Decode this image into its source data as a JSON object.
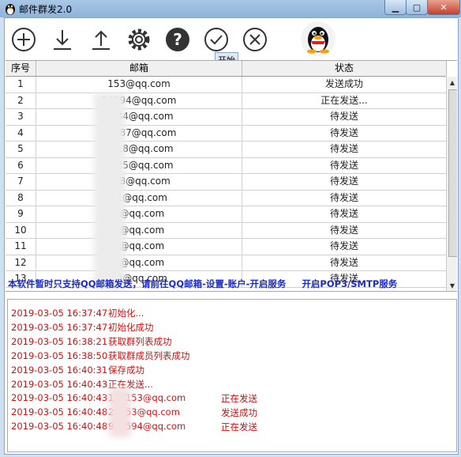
{
  "window": {
    "title": "邮件群发2.0"
  },
  "toolbar": {
    "buttons": [
      {
        "name": "add-button",
        "icon": "plus-circle-icon"
      },
      {
        "name": "import-button",
        "icon": "download-arrow-icon"
      },
      {
        "name": "export-button",
        "icon": "upload-arrow-icon"
      },
      {
        "name": "settings-button",
        "icon": "gear-icon"
      },
      {
        "name": "help-button",
        "icon": "question-icon"
      },
      {
        "name": "start-button",
        "icon": "check-circle-icon"
      },
      {
        "name": "stop-button",
        "icon": "x-circle-icon"
      }
    ],
    "tooltip": "开始",
    "qq_icon": "qq-penguin-icon"
  },
  "table": {
    "headers": {
      "index": "序号",
      "email": "邮箱",
      "status": "状态"
    },
    "rows": [
      {
        "index": "1",
        "email": "153@qq.com",
        "status": "发送成功"
      },
      {
        "index": "2",
        "email": "54594@qq.com",
        "status": "正在发送..."
      },
      {
        "index": "3",
        "email": "1834@qq.com",
        "status": "待发送"
      },
      {
        "index": "4",
        "email": "94087@qq.com",
        "status": "待发送"
      },
      {
        "index": "5",
        "email": "5418@qq.com",
        "status": "待发送"
      },
      {
        "index": "6",
        "email": "5125@qq.com",
        "status": "待发送"
      },
      {
        "index": "7",
        "email": "338@qq.com",
        "status": "待发送"
      },
      {
        "index": "8",
        "email": "01@qq.com",
        "status": "待发送"
      },
      {
        "index": "9",
        "email": "4@qq.com",
        "status": "待发送"
      },
      {
        "index": "10",
        "email": "9@qq.com",
        "status": "待发送"
      },
      {
        "index": "11",
        "email": "5@qq.com",
        "status": "待发送"
      },
      {
        "index": "12",
        "email": "6@qq.com",
        "status": "待发送"
      },
      {
        "index": "13",
        "email": "43@qq.com",
        "status": "待发送"
      }
    ]
  },
  "notice": {
    "text": "本软件暂时只支持QQ邮箱发送，请前往QQ邮箱-设置-账户-开启服务",
    "link": "开启POP3/SMTP服务"
  },
  "log": [
    {
      "time": "2019-03-05 16:37:47",
      "msg": "初始化...",
      "status": ""
    },
    {
      "time": "2019-03-05 16:37:47",
      "msg": "初始化成功",
      "status": ""
    },
    {
      "time": "2019-03-05 16:38:21",
      "msg": "获取群列表成功",
      "status": ""
    },
    {
      "time": "2019-03-05 16:38:50",
      "msg": "获取群成员列表成功",
      "status": ""
    },
    {
      "time": "2019-03-05 16:40:31",
      "msg": "保存成功",
      "status": ""
    },
    {
      "time": "2019-03-05 16:40:43",
      "msg": "正在发送...",
      "status": ""
    },
    {
      "time": "2019-03-05 16:40:43",
      "msg": "122153@qq.com",
      "status": "正在发送"
    },
    {
      "time": "2019-03-05 16:40:48",
      "msg": "22153@qq.com",
      "status": "发送成功"
    },
    {
      "time": "2019-03-05 16:40:48",
      "msg": "954594@qq.com",
      "status": "正在发送"
    }
  ],
  "colors": {
    "log_text": "#d01010",
    "notice_text": "#1a2cc8"
  }
}
